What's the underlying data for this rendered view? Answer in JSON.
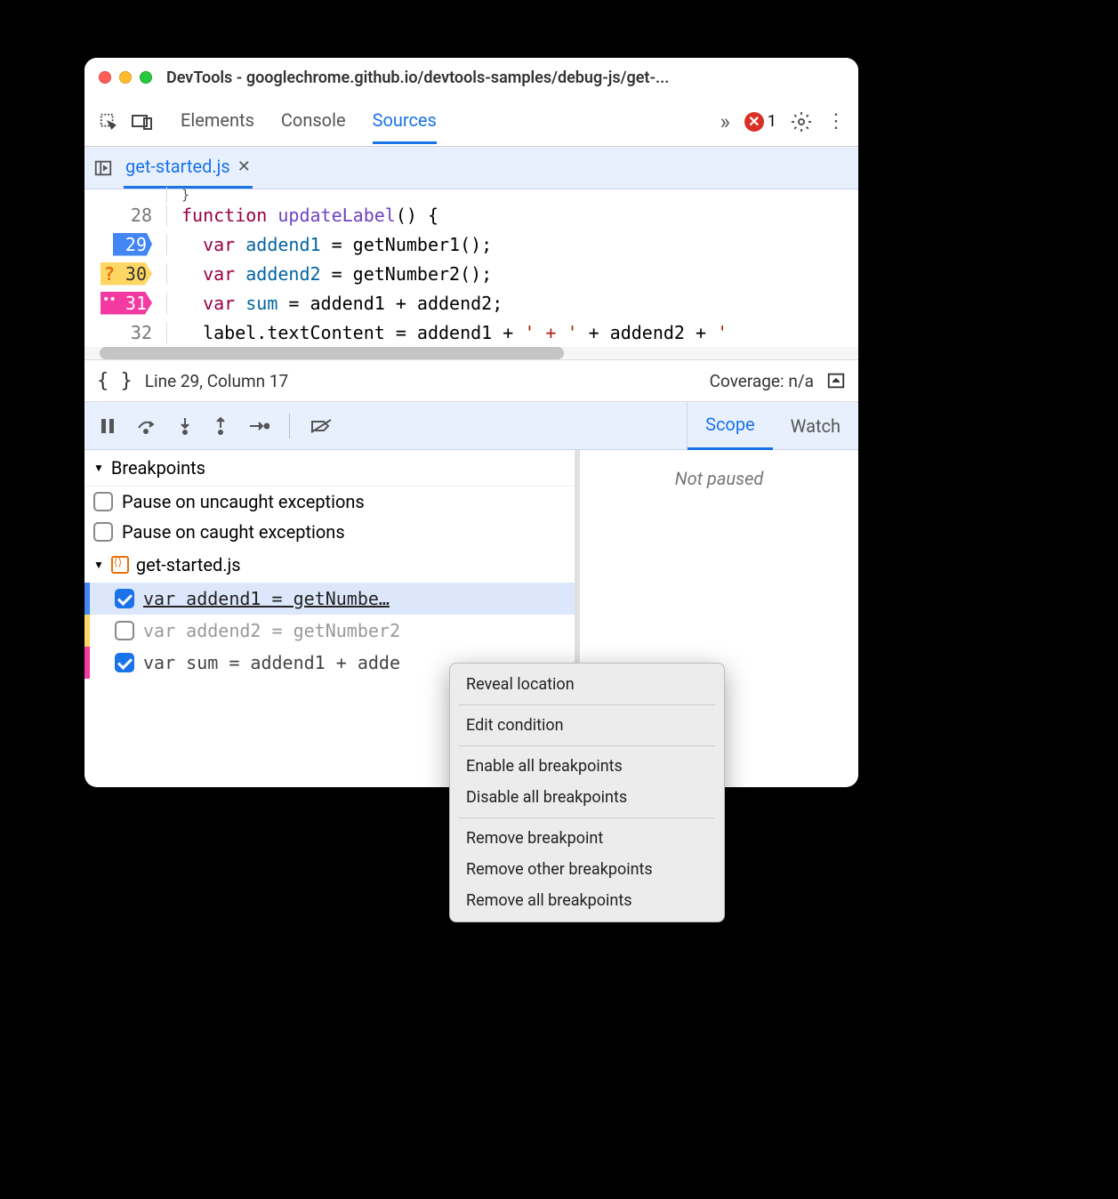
{
  "window": {
    "title": "DevTools - googlechrome.github.io/devtools-samples/debug-js/get-..."
  },
  "toolbar": {
    "tabs": [
      "Elements",
      "Console",
      "Sources"
    ],
    "active_tab": "Sources",
    "error_count": "1"
  },
  "file_tab": {
    "name": "get-started.js"
  },
  "editor": {
    "lines": [
      {
        "num": "28",
        "indent": "",
        "tokens": [
          [
            "kw",
            "function "
          ],
          [
            "fn",
            "updateLabel"
          ],
          [
            "",
            "() {"
          ]
        ]
      },
      {
        "num": "29",
        "bp": "blue",
        "indent": "  ",
        "tokens": [
          [
            "kw",
            "var "
          ],
          [
            "var",
            "addend1"
          ],
          [
            "",
            " = getNumber1();"
          ]
        ]
      },
      {
        "num": "30",
        "bp": "orange",
        "indent": "  ",
        "tokens": [
          [
            "kw",
            "var "
          ],
          [
            "var",
            "addend2"
          ],
          [
            "",
            " = getNumber2();"
          ]
        ]
      },
      {
        "num": "31",
        "bp": "pink",
        "indent": "  ",
        "tokens": [
          [
            "kw",
            "var "
          ],
          [
            "var",
            "sum"
          ],
          [
            "",
            " = addend1 + addend2;"
          ]
        ]
      },
      {
        "num": "32",
        "indent": "  ",
        "tokens": [
          [
            "",
            "label.textContent = addend1 + "
          ],
          [
            "str",
            "' + '"
          ],
          [
            "",
            " + addend2 + "
          ],
          [
            "str",
            "'"
          ]
        ]
      }
    ]
  },
  "status": {
    "position": "Line 29, Column 17",
    "coverage": "Coverage: n/a"
  },
  "debug_tabs": {
    "scope": "Scope",
    "watch": "Watch"
  },
  "right_pane_msg": "Not paused",
  "breakpoints": {
    "header": "Breakpoints",
    "pause_uncaught": "Pause on uncaught exceptions",
    "pause_caught": "Pause on caught exceptions",
    "file": "get-started.js",
    "items": [
      {
        "text": "var addend1 = getNumbe…",
        "checked": true,
        "stripe": "blue",
        "sel": true
      },
      {
        "text": "var addend2 = getNumber2",
        "checked": false,
        "stripe": "orange",
        "dim": true
      },
      {
        "text": "var sum = addend1 + adde",
        "checked": true,
        "stripe": "pink"
      }
    ]
  },
  "context_menu": {
    "groups": [
      [
        "Reveal location"
      ],
      [
        "Edit condition"
      ],
      [
        "Enable all breakpoints",
        "Disable all breakpoints"
      ],
      [
        "Remove breakpoint",
        "Remove other breakpoints",
        "Remove all breakpoints"
      ]
    ]
  }
}
